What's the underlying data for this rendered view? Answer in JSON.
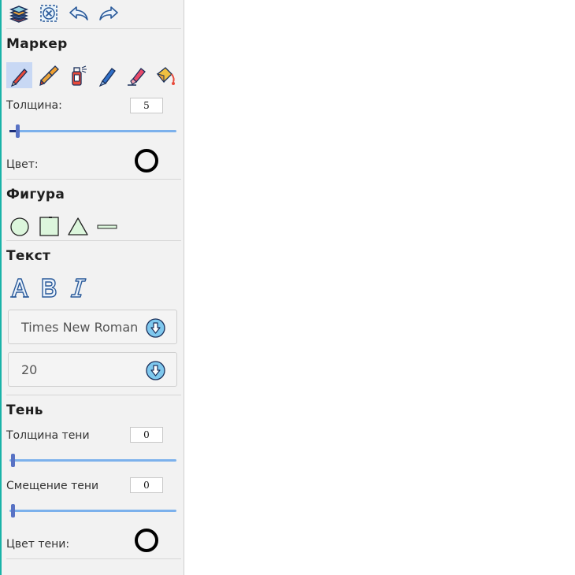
{
  "sections": {
    "marker": "Маркер",
    "shape": "Фигура",
    "text": "Текст",
    "shadow": "Тень"
  },
  "marker": {
    "thickness_label": "Толщина:",
    "thickness_value": "5",
    "thickness_fraction": 0.05,
    "color_label": "Цвет:",
    "color": "#000000"
  },
  "text": {
    "font_family": "Times New Roman",
    "font_size": "20"
  },
  "shadow": {
    "thickness_label": "Толщина тени",
    "thickness_value": "0",
    "offset_label": "Смещение тени",
    "offset_value": "0",
    "color_label": "Цвет тени:",
    "color": "#000000"
  },
  "colors": {
    "accent": "#7cb1ec",
    "thumb": "#5872c4",
    "active_tool": "#c8d8f4"
  }
}
